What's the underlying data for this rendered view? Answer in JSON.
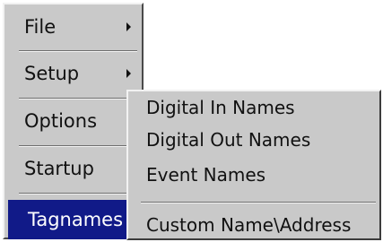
{
  "main_menu": {
    "items": [
      {
        "label": "File",
        "has_submenu": true
      },
      {
        "label": "Setup",
        "has_submenu": true
      },
      {
        "label": "Options",
        "has_submenu": false
      },
      {
        "label": "Startup",
        "has_submenu": false
      },
      {
        "label": "Tagnames",
        "has_submenu": true,
        "selected": true
      }
    ]
  },
  "sub_menu": {
    "items": [
      {
        "label": "Digital In Names"
      },
      {
        "label": "Digital Out Names"
      },
      {
        "label": "Event Names"
      },
      {
        "label": "Custom Name\\Address"
      }
    ]
  },
  "colors": {
    "menu_bg": "#c9c9c9",
    "selected_bg": "#111a88",
    "selected_text": "#ffffff"
  }
}
